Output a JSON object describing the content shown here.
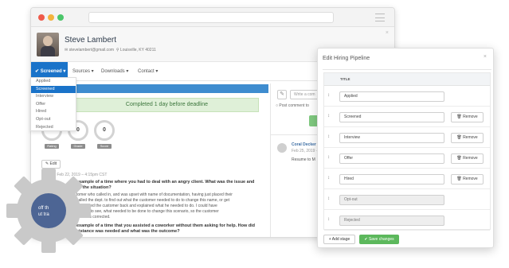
{
  "profile": {
    "name": "Steve Lambert",
    "email": "stevelambert@gmail.com",
    "location": "Louisville, KY 40211",
    "close": "×"
  },
  "nav": {
    "active": "Screened",
    "items": [
      "Sources",
      "Downloads",
      "Contact"
    ]
  },
  "dropdown": [
    "Applied",
    "Screened",
    "Interview",
    "Offer",
    "Hired",
    "Opt-out",
    "Rejected"
  ],
  "banner": "Completed 1 day before deadline",
  "scores": [
    {
      "value": "0",
      "label": "Rating"
    },
    {
      "value": "0",
      "label": "Grade"
    },
    {
      "value": "0",
      "label": "Score"
    }
  ],
  "edit_label": "Edit",
  "meta": "ted Feb 22, 2019 – 4:15pm CST",
  "q1": [
    "example of a time where you had to deal with an angry client. What was the issue and",
    "ve the situation?"
  ],
  "a1": [
    "tomer who called in, and was upset with name of documentation, having just placed their",
    "called the dept. to find out what the customer needed to do to change this name, or get",
    "hen called the customer back and explained what he needed to do. I could have",
    "wanted to see, what needed to be done to change this scenario, so the customer",
    "cuments corrected."
  ],
  "q2": [
    "example of a time that you assisted a coworker without them asking for help. How did",
    "sistance was needed and what was the outcome?"
  ],
  "overlay_text": [
    "off th",
    "ut tra"
  ],
  "comment": {
    "placeholder": "Write a com",
    "radio": "Post comment to",
    "post": "Po",
    "author": "Coral Decker",
    "date": "Feb 25, 2019 ·",
    "body": "Resume to M"
  },
  "modal": {
    "title": "Edit Hiring Pipeline",
    "close": "×",
    "col_title": "TITLE",
    "stages": [
      {
        "title": "Applied",
        "removable": false
      },
      {
        "title": "Screened",
        "removable": true
      },
      {
        "title": "Interview",
        "removable": true
      },
      {
        "title": "Offer",
        "removable": true
      },
      {
        "title": "Hired",
        "removable": true
      },
      {
        "title": "Opt-out",
        "removable": false
      },
      {
        "title": "Rejected",
        "removable": false
      }
    ],
    "remove_label": "Remove",
    "add_label": "Add stage",
    "save_label": "Save changes"
  },
  "colors": {
    "accent": "#1a73c9",
    "success": "#5cb85c",
    "gear": "#c8c8c8"
  }
}
